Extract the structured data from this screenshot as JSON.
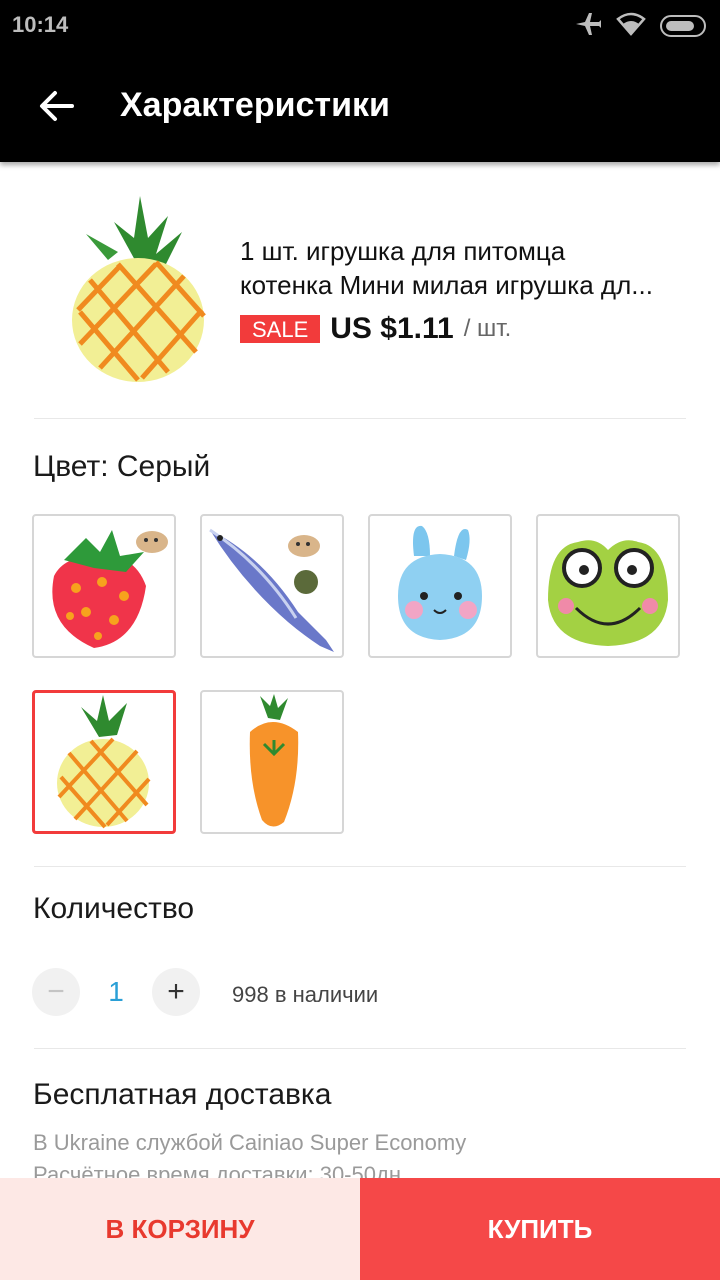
{
  "status_bar": {
    "time": "10:14",
    "icons": [
      "airplane-icon",
      "wifi-icon",
      "battery-icon"
    ]
  },
  "app_bar": {
    "title": "Характеристики",
    "back_icon": "arrow-back-icon"
  },
  "product": {
    "title_line1": "1 шт. игрушка для питомца",
    "title_line2": "котенка Мини милая игрушка дл...",
    "sale_badge": "SALE",
    "price": "US $1.11",
    "price_unit": "/ шт."
  },
  "color": {
    "label": "Цвет: Серый",
    "options": [
      {
        "name": "strawberry",
        "selected": false
      },
      {
        "name": "fish",
        "selected": false
      },
      {
        "name": "bunny",
        "selected": false
      },
      {
        "name": "frog",
        "selected": false
      },
      {
        "name": "pineapple",
        "selected": true
      },
      {
        "name": "carrot",
        "selected": false
      }
    ]
  },
  "quantity": {
    "label": "Количество",
    "minus": "−",
    "value": "1",
    "plus": "+",
    "stock": "998 в наличии"
  },
  "shipping": {
    "title": "Бесплатная доставка",
    "line1": "В Ukraine службой Cainiao Super Economy",
    "line2": "Расчётное время доставки: 30-50дн"
  },
  "actions": {
    "cart": "В КОРЗИНУ",
    "buy": "КУПИТЬ"
  },
  "colors": {
    "accent": "#f23b3b",
    "buy_bg": "#f54848",
    "cart_bg": "#fde8e5",
    "qty_value": "#2a9fd6"
  }
}
